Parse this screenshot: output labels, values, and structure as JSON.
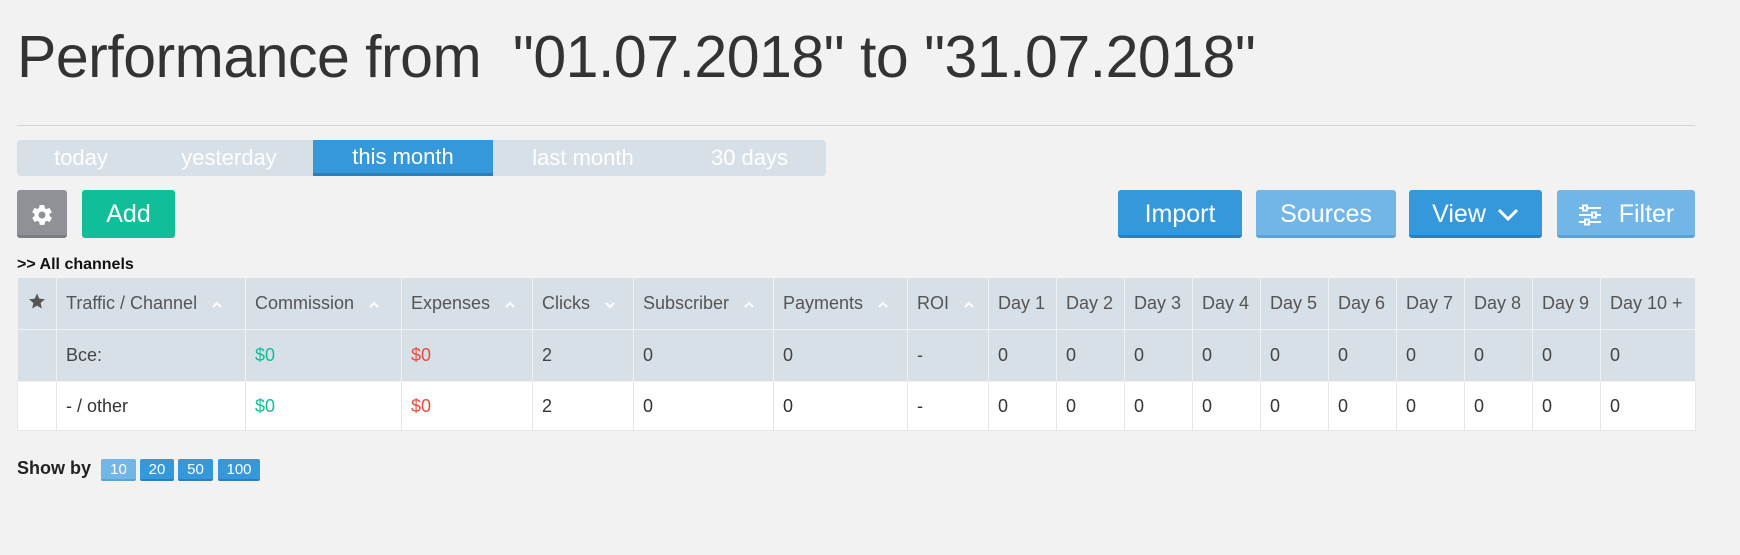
{
  "page": {
    "title": "Performance from  \"01.07.2018\" to \"31.07.2018\""
  },
  "periods": [
    {
      "label": "today",
      "active": false
    },
    {
      "label": "yesterday",
      "active": false
    },
    {
      "label": "this month",
      "active": true
    },
    {
      "label": "last month",
      "active": false
    },
    {
      "label": "30 days",
      "active": false
    }
  ],
  "toolbar": {
    "settings_icon": "gear-icon",
    "add_label": "Add",
    "import_label": "Import",
    "sources_label": "Sources",
    "view_label": "View",
    "view_icon": "chevron-down-icon",
    "filter_label": "Filter",
    "filter_icon": "sliders-icon"
  },
  "breadcrumb": {
    "prefix": ">>",
    "label": "All channels"
  },
  "table": {
    "columns": [
      {
        "label": "",
        "icon": "star-icon",
        "sortable": false
      },
      {
        "label": "Traffic / Channel",
        "sortable": true,
        "sort": "asc"
      },
      {
        "label": "Commission",
        "sortable": true,
        "sort": "asc"
      },
      {
        "label": "Expenses",
        "sortable": true,
        "sort": "asc"
      },
      {
        "label": "Clicks",
        "sortable": true,
        "sort": "desc"
      },
      {
        "label": "Subscriber",
        "sortable": true,
        "sort": "asc"
      },
      {
        "label": "Payments",
        "sortable": true,
        "sort": "asc"
      },
      {
        "label": "ROI",
        "sortable": true,
        "sort": "asc"
      },
      {
        "label": "Day 1",
        "sortable": false
      },
      {
        "label": "Day 2",
        "sortable": false
      },
      {
        "label": "Day 3",
        "sortable": false
      },
      {
        "label": "Day 4",
        "sortable": false
      },
      {
        "label": "Day 5",
        "sortable": false
      },
      {
        "label": "Day 6",
        "sortable": false
      },
      {
        "label": "Day 7",
        "sortable": false
      },
      {
        "label": "Day 8",
        "sortable": false
      },
      {
        "label": "Day 9",
        "sortable": false
      },
      {
        "label": "Day 10 +",
        "sortable": false
      }
    ],
    "total_row": [
      "",
      "Все:",
      "$0",
      "$0",
      "2",
      "0",
      "0",
      "-",
      "0",
      "0",
      "0",
      "0",
      "0",
      "0",
      "0",
      "0",
      "0",
      "0"
    ],
    "rows": [
      [
        "",
        "- / other",
        "$0",
        "$0",
        "2",
        "0",
        "0",
        "-",
        "0",
        "0",
        "0",
        "0",
        "0",
        "0",
        "0",
        "0",
        "0",
        "0"
      ]
    ]
  },
  "pagination": {
    "label": "Show by",
    "options": [
      {
        "label": "10",
        "active": true
      },
      {
        "label": "20",
        "active": false
      },
      {
        "label": "50",
        "active": false
      },
      {
        "label": "100",
        "active": false
      }
    ]
  },
  "colors": {
    "primary": "#3498db",
    "primary_light": "#72b6e7",
    "success": "#10be9a",
    "danger": "#e74c3c",
    "header_bg": "#d7e0e7",
    "gear_button": "#8e9196"
  }
}
